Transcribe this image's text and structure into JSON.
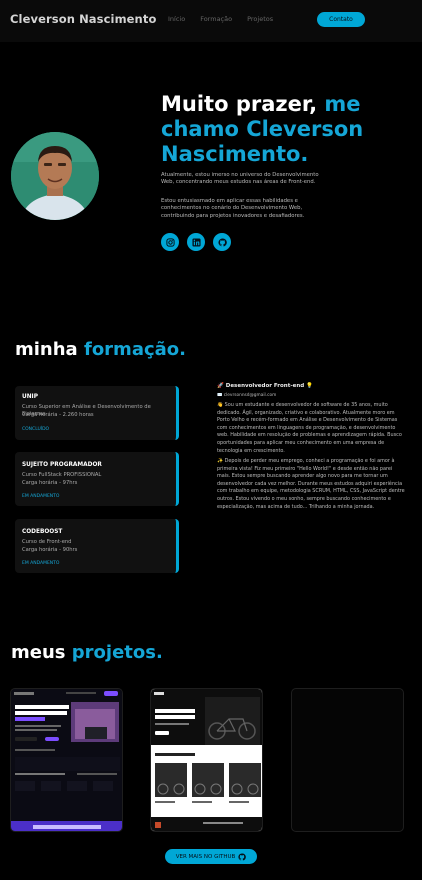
{
  "header": {
    "brand": "Cleverson Nascimento",
    "nav": [
      "Início",
      "Formação",
      "Projetos"
    ],
    "contact_label": "Contato"
  },
  "hero": {
    "title_line1_white": "Muito prazer,",
    "title_line1_blue": "me",
    "title_line2": "chamo Cleverson",
    "title_line3": "Nascimento.",
    "paragraph1": "Atualmente, estou imerso no universo do Desenvolvimento Web, concentrando meus estudos nas áreas de Front-end.",
    "paragraph2": "Estou entusiasmado em aplicar essas habilidades e conhecimentos no cenário do Desenvolvimento Web, contribuindo para projetos inovadores e desafiadores.",
    "socials": [
      "instagram-icon",
      "linkedin-icon",
      "github-icon"
    ]
  },
  "education": {
    "title_white": "minha",
    "title_blue": "formação.",
    "cards": [
      {
        "title": "UNIP",
        "desc1": "Curso Superior em Análise e Desenvolvimento de Sistemas",
        "desc2": "Carga horária - 2.260 horas",
        "status": "CONCLUÍDO"
      },
      {
        "title": "SUJEITO PROGRAMADOR",
        "desc1": "Curso FullStack PROFISSIONAL",
        "desc2": "Carga horária - 97hrs",
        "status": "EM ANDAMENTO"
      },
      {
        "title": "CODEBOOST",
        "desc1": "Curso de Front-end",
        "desc2": "Carga horária - 90hrs",
        "status": "EM ANDAMENTO"
      }
    ],
    "about_role": "🚀 Desenvolvedor Front-end 💡",
    "about_email": "✉️ clevrsonnsd@gmail.com",
    "about_p1": "👋 Sou um estudante e desenvolvedor de software de 35 anos, muito dedicado. Ágil, organizado, criativo e colaborativo. Atualmente moro em Porto Velho e recém-formado em Análise e Desenvolvimento de Sistemas com conhecimentos em linguagens de programação, e desenvolvimento web. Habilidade em resolução de problemas e aprendizagem rápida. Busco oportunidades para aplicar meu conhecimento em uma empresa de tecnologia em crescimento.",
    "about_p2": "✨ Depois de perder meu emprego, conheci a programação e foi amor à primeira vista! Fiz meu primeiro \"Hello World!\" e desde então não parei mais. Estou sempre buscando aprender algo novo para me tornar um desenvolvedor cada vez melhor. Durante meus estudos adquiri experiência com trabalho em equipe, metodologia SCRUM, HTML, CSS, JavaScript dentre outros. Estou vivendo o meu sonho, sempre buscando conhecimento e especialização, mas acima de tudo... Trilhando a minha jornada."
  },
  "projects": {
    "title_white": "meus",
    "title_blue": "projetos.",
    "p1": {
      "headline": "Promova Seu Café marketing perfeito para sua empresa",
      "cta": "Inscreva-se"
    },
    "p2": {
      "headline": "Bicicletas feitas sob medida.",
      "section": "Escolha a sua"
    },
    "github_label": "VER MAIS NO GITHUB"
  },
  "colors": {
    "accent": "#00a7d6",
    "accent_text": "#15a6d6",
    "background": "#000000"
  }
}
